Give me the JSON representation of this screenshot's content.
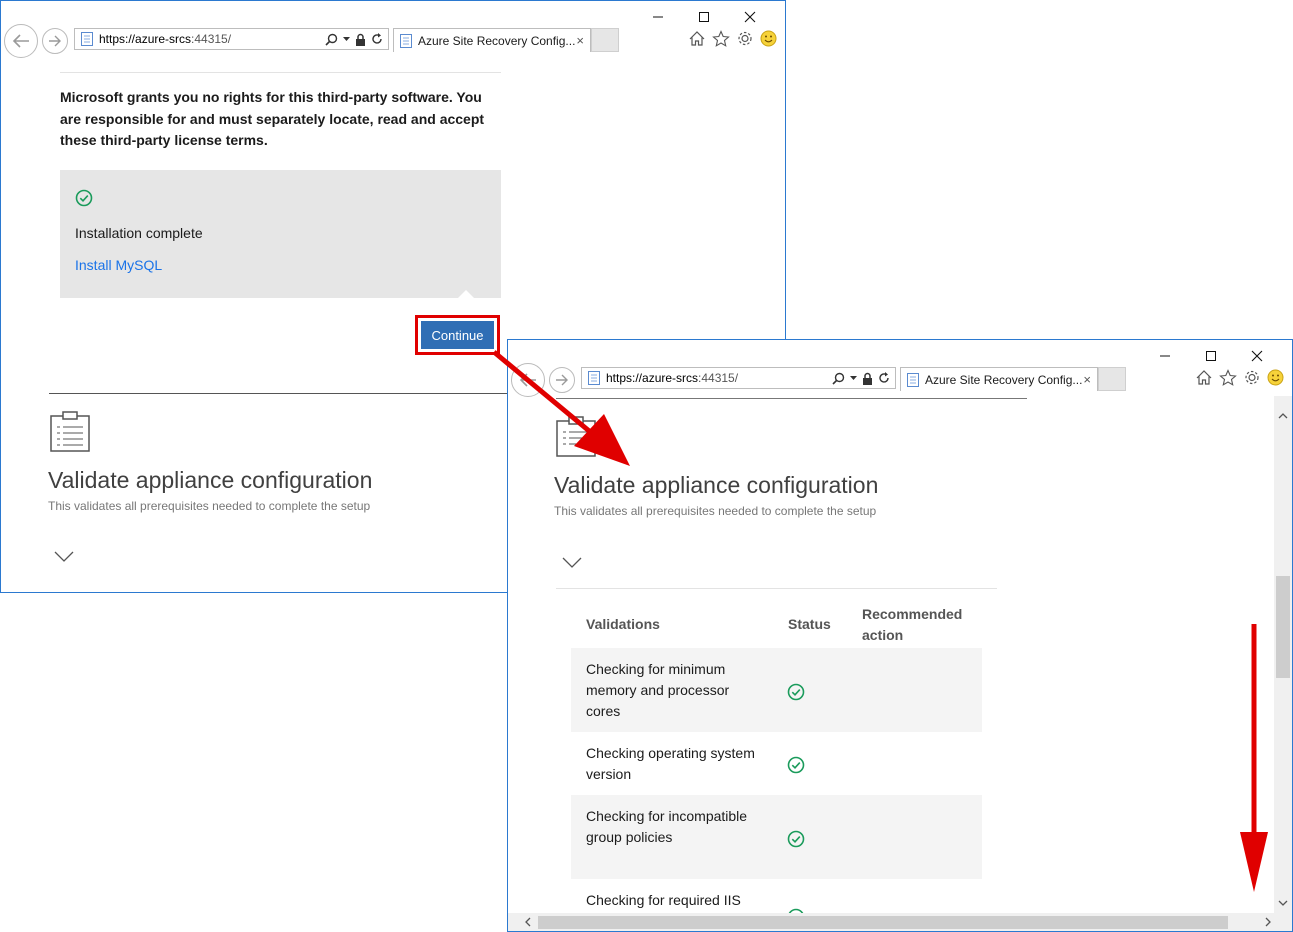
{
  "browser": {
    "url_host": "https://azure-srcs",
    "url_port": ":44315/",
    "tab_title": "Azure Site Recovery Config...",
    "tab_close": "×",
    "back_icon": "back-arrow-icon",
    "forward_icon": "forward-arrow-icon",
    "caption_minimize": "—",
    "caption_maximize": "☐",
    "caption_close": "✕"
  },
  "window1": {
    "license_text": "Microsoft grants you no rights for this third-party software. You are responsible for and must separately locate, read and accept these third-party license terms.",
    "status_text": "Installation complete",
    "install_link": "Install MySQL",
    "continue_label": "Continue",
    "section_title": "Validate appliance configuration",
    "section_subtitle": "This validates all prerequisites needed to complete the setup"
  },
  "window2": {
    "section_title": "Validate appliance configuration",
    "section_subtitle": "This validates all prerequisites needed to complete the setup",
    "table": {
      "headers": [
        "Validations",
        "Status",
        "Recommended action"
      ],
      "rows": [
        {
          "validation": "Checking for minimum memory and processor cores",
          "status": "success"
        },
        {
          "validation": "Checking operating system version",
          "status": "success"
        },
        {
          "validation": "Checking for incompatible group policies",
          "status": "success"
        },
        {
          "validation": "Checking for required IIS",
          "status": "success"
        }
      ]
    }
  },
  "colors": {
    "accent": "#2f6eb5",
    "link": "#1a73e8",
    "success": "#1a9b5b",
    "highlight": "#e00000",
    "window_border": "#2b79d0"
  }
}
